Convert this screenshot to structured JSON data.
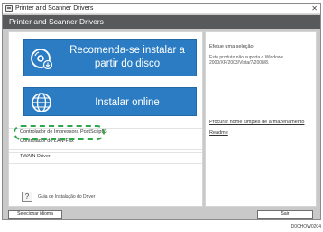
{
  "window": {
    "title": "Printer and Scanner Drivers",
    "close_glyph": "✕",
    "app_icon": "printer-icon"
  },
  "header": {
    "title": "Printer and Scanner Drivers"
  },
  "main": {
    "install_disc_label": "Recomenda-se instalar a partir do disco",
    "install_disc_icon": "disc-install-icon",
    "install_online_label": "Instalar online",
    "install_online_icon": "globe-icon",
    "button_color": "#2b7cc3",
    "driver_items": [
      "Controlador de Impressora PostScript 3",
      "Controlador do LAN-Fax",
      "TWAIN Driver"
    ],
    "highlight_color": "#2ca84a",
    "help_glyph": "?",
    "help_label": "Guia de Instalação do Driver"
  },
  "info": {
    "select_prompt": "Efetue uma seleção.",
    "os_note": "Este produto não suporta o Windows 2000/XP/2003/Vista/7/2008/8.",
    "search_link": "Procurar nome simples de armazenamento",
    "readme_link": "Readme"
  },
  "footer": {
    "language_button": "Selecionar idioma",
    "exit_button": "Sair",
    "code": "D0CHOW0204"
  }
}
